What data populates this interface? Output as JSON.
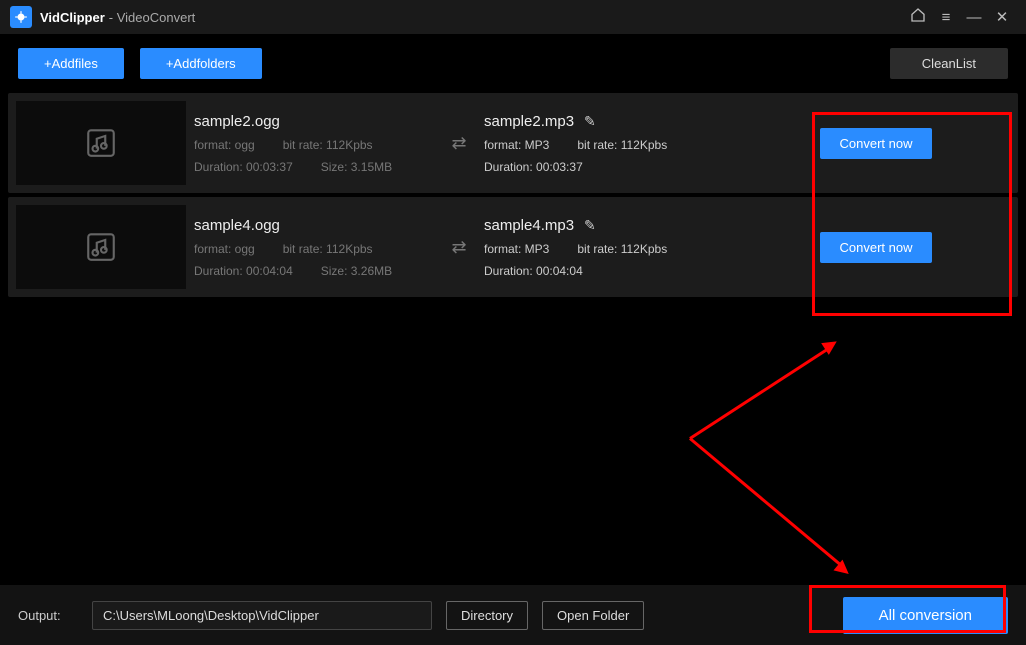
{
  "title": {
    "app": "VidClipper",
    "sub": "- VideoConvert"
  },
  "toolbar": {
    "addFiles": "+Addfiles",
    "addFolders": "+Addfolders",
    "cleanList": "CleanList"
  },
  "files": [
    {
      "srcName": "sample2.ogg",
      "srcFormat": "format: ogg",
      "srcBitrate": "bit rate: 112Kpbs",
      "srcDuration": "Duration: 00:03:37",
      "srcSize": "Size: 3.15MB",
      "dstName": "sample2.mp3",
      "dstFormat": "format: MP3",
      "dstBitrate": "bit rate: 112Kpbs",
      "dstDuration": "Duration: 00:03:37",
      "convert": "Convert now"
    },
    {
      "srcName": "sample4.ogg",
      "srcFormat": "format: ogg",
      "srcBitrate": "bit rate: 112Kpbs",
      "srcDuration": "Duration: 00:04:04",
      "srcSize": "Size: 3.26MB",
      "dstName": "sample4.mp3",
      "dstFormat": "format: MP3",
      "dstBitrate": "bit rate: 112Kpbs",
      "dstDuration": "Duration: 00:04:04",
      "convert": "Convert now"
    }
  ],
  "output": {
    "label": "Output:",
    "path": "C:\\Users\\MLoong\\Desktop\\VidClipper",
    "directory": "Directory",
    "openFolder": "Open Folder"
  },
  "allConversion": "All conversion"
}
